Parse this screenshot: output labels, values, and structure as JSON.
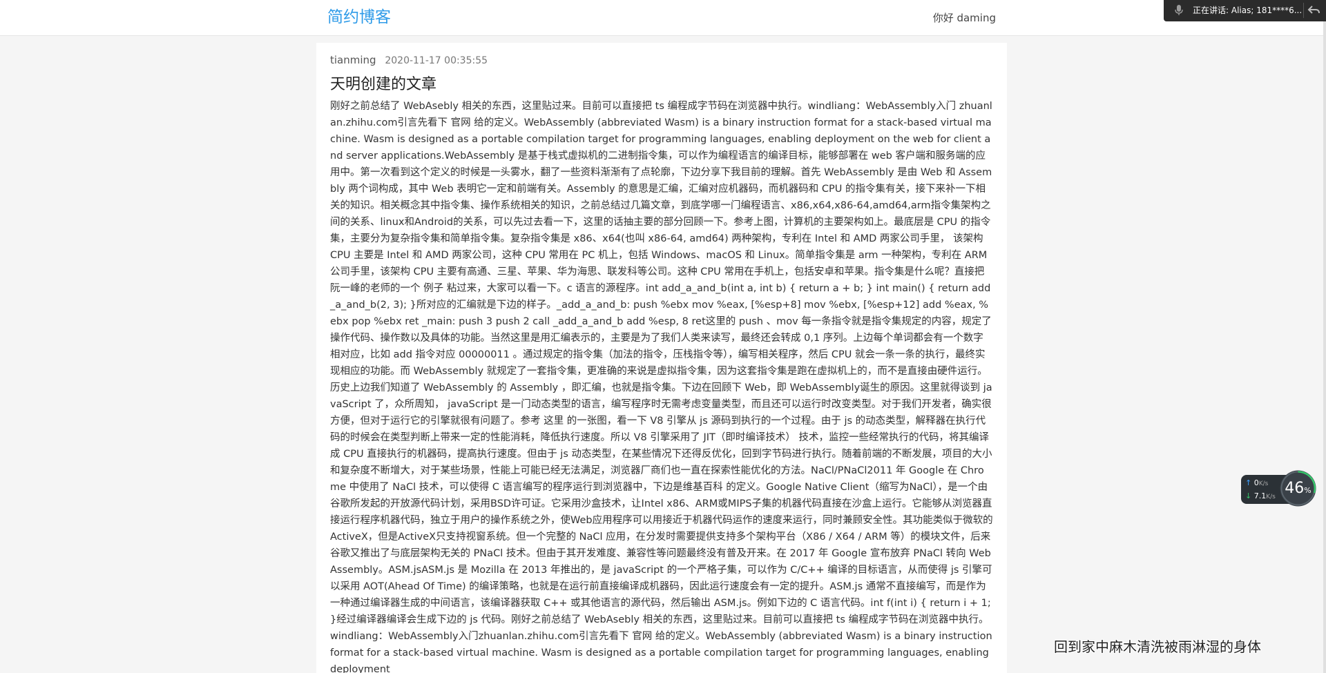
{
  "navbar": {
    "brand": "简约博客",
    "greeting": "你好 daming"
  },
  "voice_bar": {
    "text": "正在讲话: Alias; 181****6...",
    "mic_icon": "microphone-icon",
    "back_icon": "undo-arrow-icon"
  },
  "network_widget": {
    "upload_value": "0",
    "upload_unit": "K/s",
    "download_value": "7.1",
    "download_unit": "K/s",
    "percent": "46",
    "percent_unit": "%"
  },
  "post": {
    "author": "tianming",
    "date": "2020-11-17 00:35:55",
    "title": "天明创建的文章",
    "content": "刚好之前总结了 WebAsebly 相关的东西，这里贴过来。目前可以直接把 ts 编程成字节码在浏览器中执行。windliang：WebAssembly入门 zhuanlan.zhihu.com引言先看下 官网 给的定义。WebAssembly (abbreviated Wasm) is a binary instruction format for a stack-based virtual machine. Wasm is designed as a portable compilation target for programming languages, enabling deployment on the web for client and server applications.WebAssembly 是基于栈式虚拟机的二进制指令集，可以作为编程语言的编译目标，能够部署在 web 客户端和服务端的应用中。第一次看到这个定义的时候是一头雾水，翻了一些资料渐渐有了点轮廓，下边分享下我目前的理解。首先 WebAssembly 是由 Web 和 Assembly 两个词构成，其中 Web 表明它一定和前端有关。Assembly 的意思是汇编，汇编对应机器码，而机器码和 CPU 的指令集有关，接下来补一下相关的知识。相关概念其中指令集、操作系统相关的知识，之前总结过几篇文章，到底学哪一门编程语言、x86,x64,x86-64,amd64,arm指令集架构之间的关系、linux和Android的关系，可以先过去看一下，这里的话抽主要的部分回顾一下。参考上图，计算机的主要架构如上。最底层是 CPU 的指令集，主要分为复杂指令集和简单指令集。复杂指令集是 x86、x64(也叫 x86-64, amd64) 两种架构，专利在 Intel 和 AMD 两家公司手里， 该架构 CPU 主要是 Intel 和 AMD 两家公司，这种 CPU 常用在 PC 机上，包括 Windows、macOS 和 Linux。简单指令集是 arm 一种架构，专利在 ARM 公司手里，该架构 CPU 主要有高通、三星、苹果、华为海思、联发科等公司。这种 CPU 常用在手机上，包括安卓和苹果。指令集是什么呢？直接把阮一峰的老师的一个 例子 粘过来，大家可以看一下。c 语言的源程序。int add_a_and_b(int a, int b) { return a + b; } int main() { return add_a_and_b(2, 3); }所对应的汇编就是下边的样子。_add_a_and_b: push %ebx mov %eax, [%esp+8] mov %ebx, [%esp+12] add %eax, %ebx pop %ebx ret _main: push 3 push 2 call _add_a_and_b add %esp, 8 ret这里的 push 、mov 每一条指令就是指令集规定的内容，规定了操作代码、操作数以及具体的功能。当然这里是用汇编表示的，主要是为了我们人类来读写，最终还会转成 0,1 序列。上边每个单词都会有一个数字相对应，比如 add 指令对应 00000011 。通过规定的指令集（加法的指令，压栈指令等），编写相关程序，然后 CPU 就会一条一条的执行，最终实现相应的功能。而 WebAssembly 就规定了一套指令集，更准确的来说是虚拟指令集，因为这套指令集是跑在虚拟机上的，而不是直接由硬件运行。历史上边我们知道了 WebAssembly 的 Assembly ，即汇编，也就是指令集。下边在回顾下 Web，即 WebAssembly诞生的原因。这里就得谈到 javaScript 了，众所周知， javaScript 是一门动态类型的语言，编写程序时无需考虑变量类型，而且还可以运行时改变类型。对于我们开发者，确实很方便，但对于运行它的引擎就很有问题了。参考 这里 的一张图，看一下 V8 引擎从 js 源码到执行的一个过程。由于 js 的动态类型，解释器在执行代码的时候会在类型判断上带来一定的性能消耗，降低执行速度。所以 V8 引擎采用了 JIT（即时编译技术） 技术，监控一些经常执行的代码，将其编译成 CPU 直接执行的机器码，提高执行速度。但由于 js 动态类型，在某些情况下还得反优化，回到字节码进行执行。随着前端的不断发展，项目的大小和复杂度不断增大，对于某些场景，性能上可能已经无法满足，浏览器厂商们也一直在探索性能优化的方法。NaCl/PNaCl2011 年 Google 在 Chrome 中使用了 NaCl 技术，可以使得 C 语言编写的程序运行到浏览器中，下边是维基百科 的定义。Google Native Client（缩写为NaCl），是一个由谷歌所发起的开放源代码计划，采用BSD许可证。它采用沙盒技术，让Intel x86、ARM或MIPS子集的机器代码直接在沙盒上运行。它能够从浏览器直接运行程序机器代码，独立于用户的操作系统之外，使Web应用程序可以用接近于机器代码运作的速度来运行，同时兼顾安全性。其功能类似于微软的 ActiveX，但是ActiveX只支持视窗系统。但一个完整的 NaCl 应用，在分发时需要提供支持多个架构平台（X86 / X64 / ARM 等）的模块文件，后来谷歌又推出了与底层架构无关的 PNaCl 技术。但由于其开发难度、兼容性等问题最终没有普及开来。在 2017 年 Google 宣布放弃 PNaCl 转向 WebAssembly。ASM.jsASM.js 是 Mozilla 在 2013 年推出的，是 javaScript 的一个严格子集，可以作为 C/C++ 编译的目标语言，从而使得 js 引擎可以采用 AOT(Ahead Of Time) 的编译策略，也就是在运行前直接编译成机器码，因此运行速度会有一定的提升。ASM.js 通常不直接编写，而是作为一种通过编译器生成的中间语言，该编译器获取 C++ 或其他语言的源代码，然后输出 ASM.js。例如下边的 C 语言代码。int f(int i) { return i + 1; }经过编译器编译会生成下边的 js 代码。刚好之前总结了 WebAsebly 相关的东西，这里贴过来。目前可以直接把 ts 编程成字节码在浏览器中执行。windliang：WebAssembly入门zhuanlan.zhihu.com引言先看下 官网 给的定义。WebAssembly (abbreviated Wasm) is a binary instruction format for a stack-based virtual machine. Wasm is designed as a portable compilation target for programming languages, enabling deployment"
  },
  "lyric": "回到家中麻木清洗被雨淋湿的身体"
}
